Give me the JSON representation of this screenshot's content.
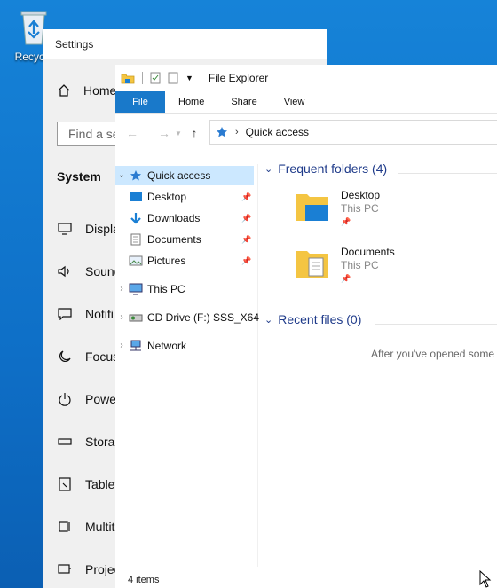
{
  "desktop": {
    "recycle_label": "Recycle"
  },
  "settings": {
    "title": "Settings",
    "home": "Home",
    "search_placeholder": "Find a se",
    "section": "System",
    "items": [
      {
        "label": "Displa"
      },
      {
        "label": "Sound"
      },
      {
        "label": "Notifi"
      },
      {
        "label": "Focus"
      },
      {
        "label": "Power"
      },
      {
        "label": "Storag"
      },
      {
        "label": "Tablet"
      },
      {
        "label": "Multit"
      },
      {
        "label": "Projec"
      }
    ]
  },
  "explorer": {
    "title": "File Explorer",
    "ribbon_tabs": [
      "File",
      "Home",
      "Share",
      "View"
    ],
    "address": "Quick access",
    "nav": [
      {
        "label": "Quick access"
      },
      {
        "label": "Desktop"
      },
      {
        "label": "Downloads"
      },
      {
        "label": "Documents"
      },
      {
        "label": "Pictures"
      },
      {
        "label": "This PC"
      },
      {
        "label": "CD Drive (F:) SSS_X64"
      },
      {
        "label": "Network"
      }
    ],
    "frequent_header": "Frequent folders (4)",
    "folders": [
      {
        "name": "Desktop",
        "location": "This PC"
      },
      {
        "name": "Documents",
        "location": "This PC"
      }
    ],
    "recent_header": "Recent files (0)",
    "recent_empty": "After you've opened some",
    "status": "4 items"
  },
  "colors": {
    "accent": "#1979ca",
    "selection": "#cce8ff",
    "header_text": "#1f3b8a"
  }
}
